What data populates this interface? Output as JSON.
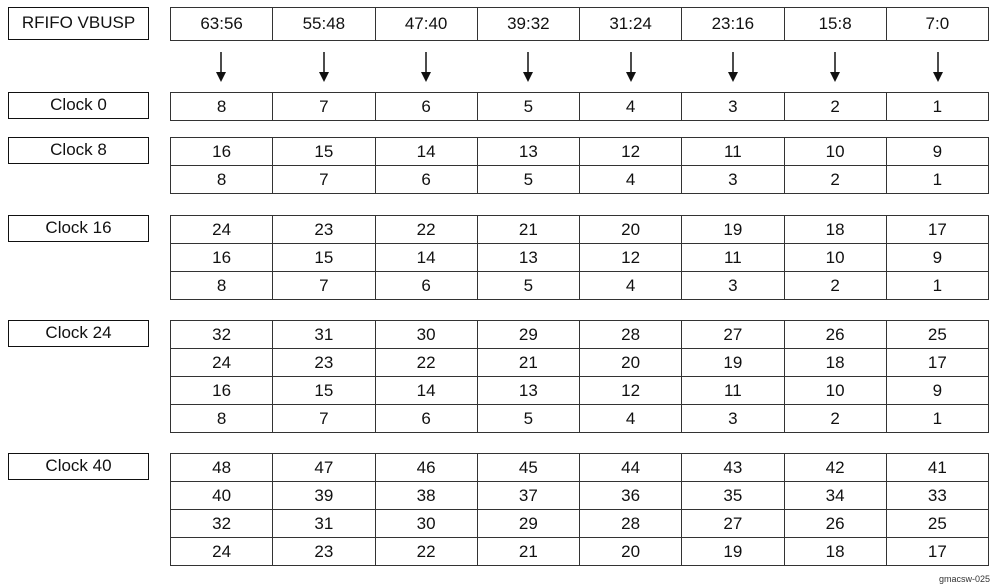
{
  "header": {
    "label": "RFIFO VBUSP",
    "columns": [
      "63:56",
      "55:48",
      "47:40",
      "39:32",
      "31:24",
      "23:16",
      "15:8",
      "7:0"
    ]
  },
  "arrow_icon": "down-arrow-icon",
  "groups": [
    {
      "label": "Clock 0",
      "rows": [
        [
          "8",
          "7",
          "6",
          "5",
          "4",
          "3",
          "2",
          "1"
        ]
      ]
    },
    {
      "label": "Clock 8",
      "rows": [
        [
          "16",
          "15",
          "14",
          "13",
          "12",
          "11",
          "10",
          "9"
        ],
        [
          "8",
          "7",
          "6",
          "5",
          "4",
          "3",
          "2",
          "1"
        ]
      ]
    },
    {
      "label": "Clock 16",
      "rows": [
        [
          "24",
          "23",
          "22",
          "21",
          "20",
          "19",
          "18",
          "17"
        ],
        [
          "16",
          "15",
          "14",
          "13",
          "12",
          "11",
          "10",
          "9"
        ],
        [
          "8",
          "7",
          "6",
          "5",
          "4",
          "3",
          "2",
          "1"
        ]
      ]
    },
    {
      "label": "Clock 24",
      "rows": [
        [
          "32",
          "31",
          "30",
          "29",
          "28",
          "27",
          "26",
          "25"
        ],
        [
          "24",
          "23",
          "22",
          "21",
          "20",
          "19",
          "18",
          "17"
        ],
        [
          "16",
          "15",
          "14",
          "13",
          "12",
          "11",
          "10",
          "9"
        ],
        [
          "8",
          "7",
          "6",
          "5",
          "4",
          "3",
          "2",
          "1"
        ]
      ]
    },
    {
      "label": "Clock 40",
      "rows": [
        [
          "48",
          "47",
          "46",
          "45",
          "44",
          "43",
          "42",
          "41"
        ],
        [
          "40",
          "39",
          "38",
          "37",
          "36",
          "35",
          "34",
          "33"
        ],
        [
          "32",
          "31",
          "30",
          "29",
          "28",
          "27",
          "26",
          "25"
        ],
        [
          "24",
          "23",
          "22",
          "21",
          "20",
          "19",
          "18",
          "17"
        ]
      ]
    }
  ],
  "figure_id": "gmacsw-025"
}
